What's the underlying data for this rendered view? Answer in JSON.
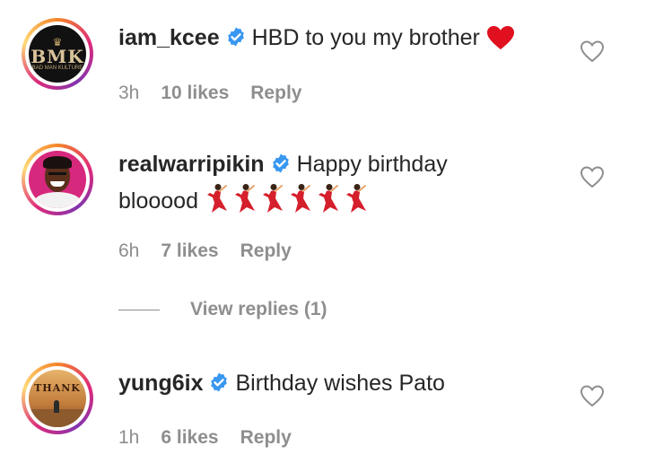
{
  "comments": [
    {
      "username": "iam_kcee",
      "text": "HBD to you my brother",
      "emoji": "red-heart",
      "time": "3h",
      "likes": "10 likes",
      "reply": "Reply",
      "avatar": {
        "top_text": "BMK",
        "bottom_text": "BAD MAN KULTURE"
      }
    },
    {
      "username": "realwarripikin",
      "text": "Happy birthday",
      "text2": "blooood",
      "emoji": "dancer x6",
      "time": "6h",
      "likes": "7 likes",
      "reply": "Reply"
    },
    {
      "username": "yung6ix",
      "text": "Birthday wishes Pato",
      "time": "1h",
      "likes": "6 likes",
      "reply": "Reply",
      "avatar": {
        "title_text": "THANK"
      }
    }
  ],
  "view_replies": "View replies (1)",
  "colors": {
    "text": "#262626",
    "muted": "#8e8e8e",
    "verified": "#3897f0",
    "heart_emoji": "#e0101f",
    "dancer": "#d61f2c"
  }
}
